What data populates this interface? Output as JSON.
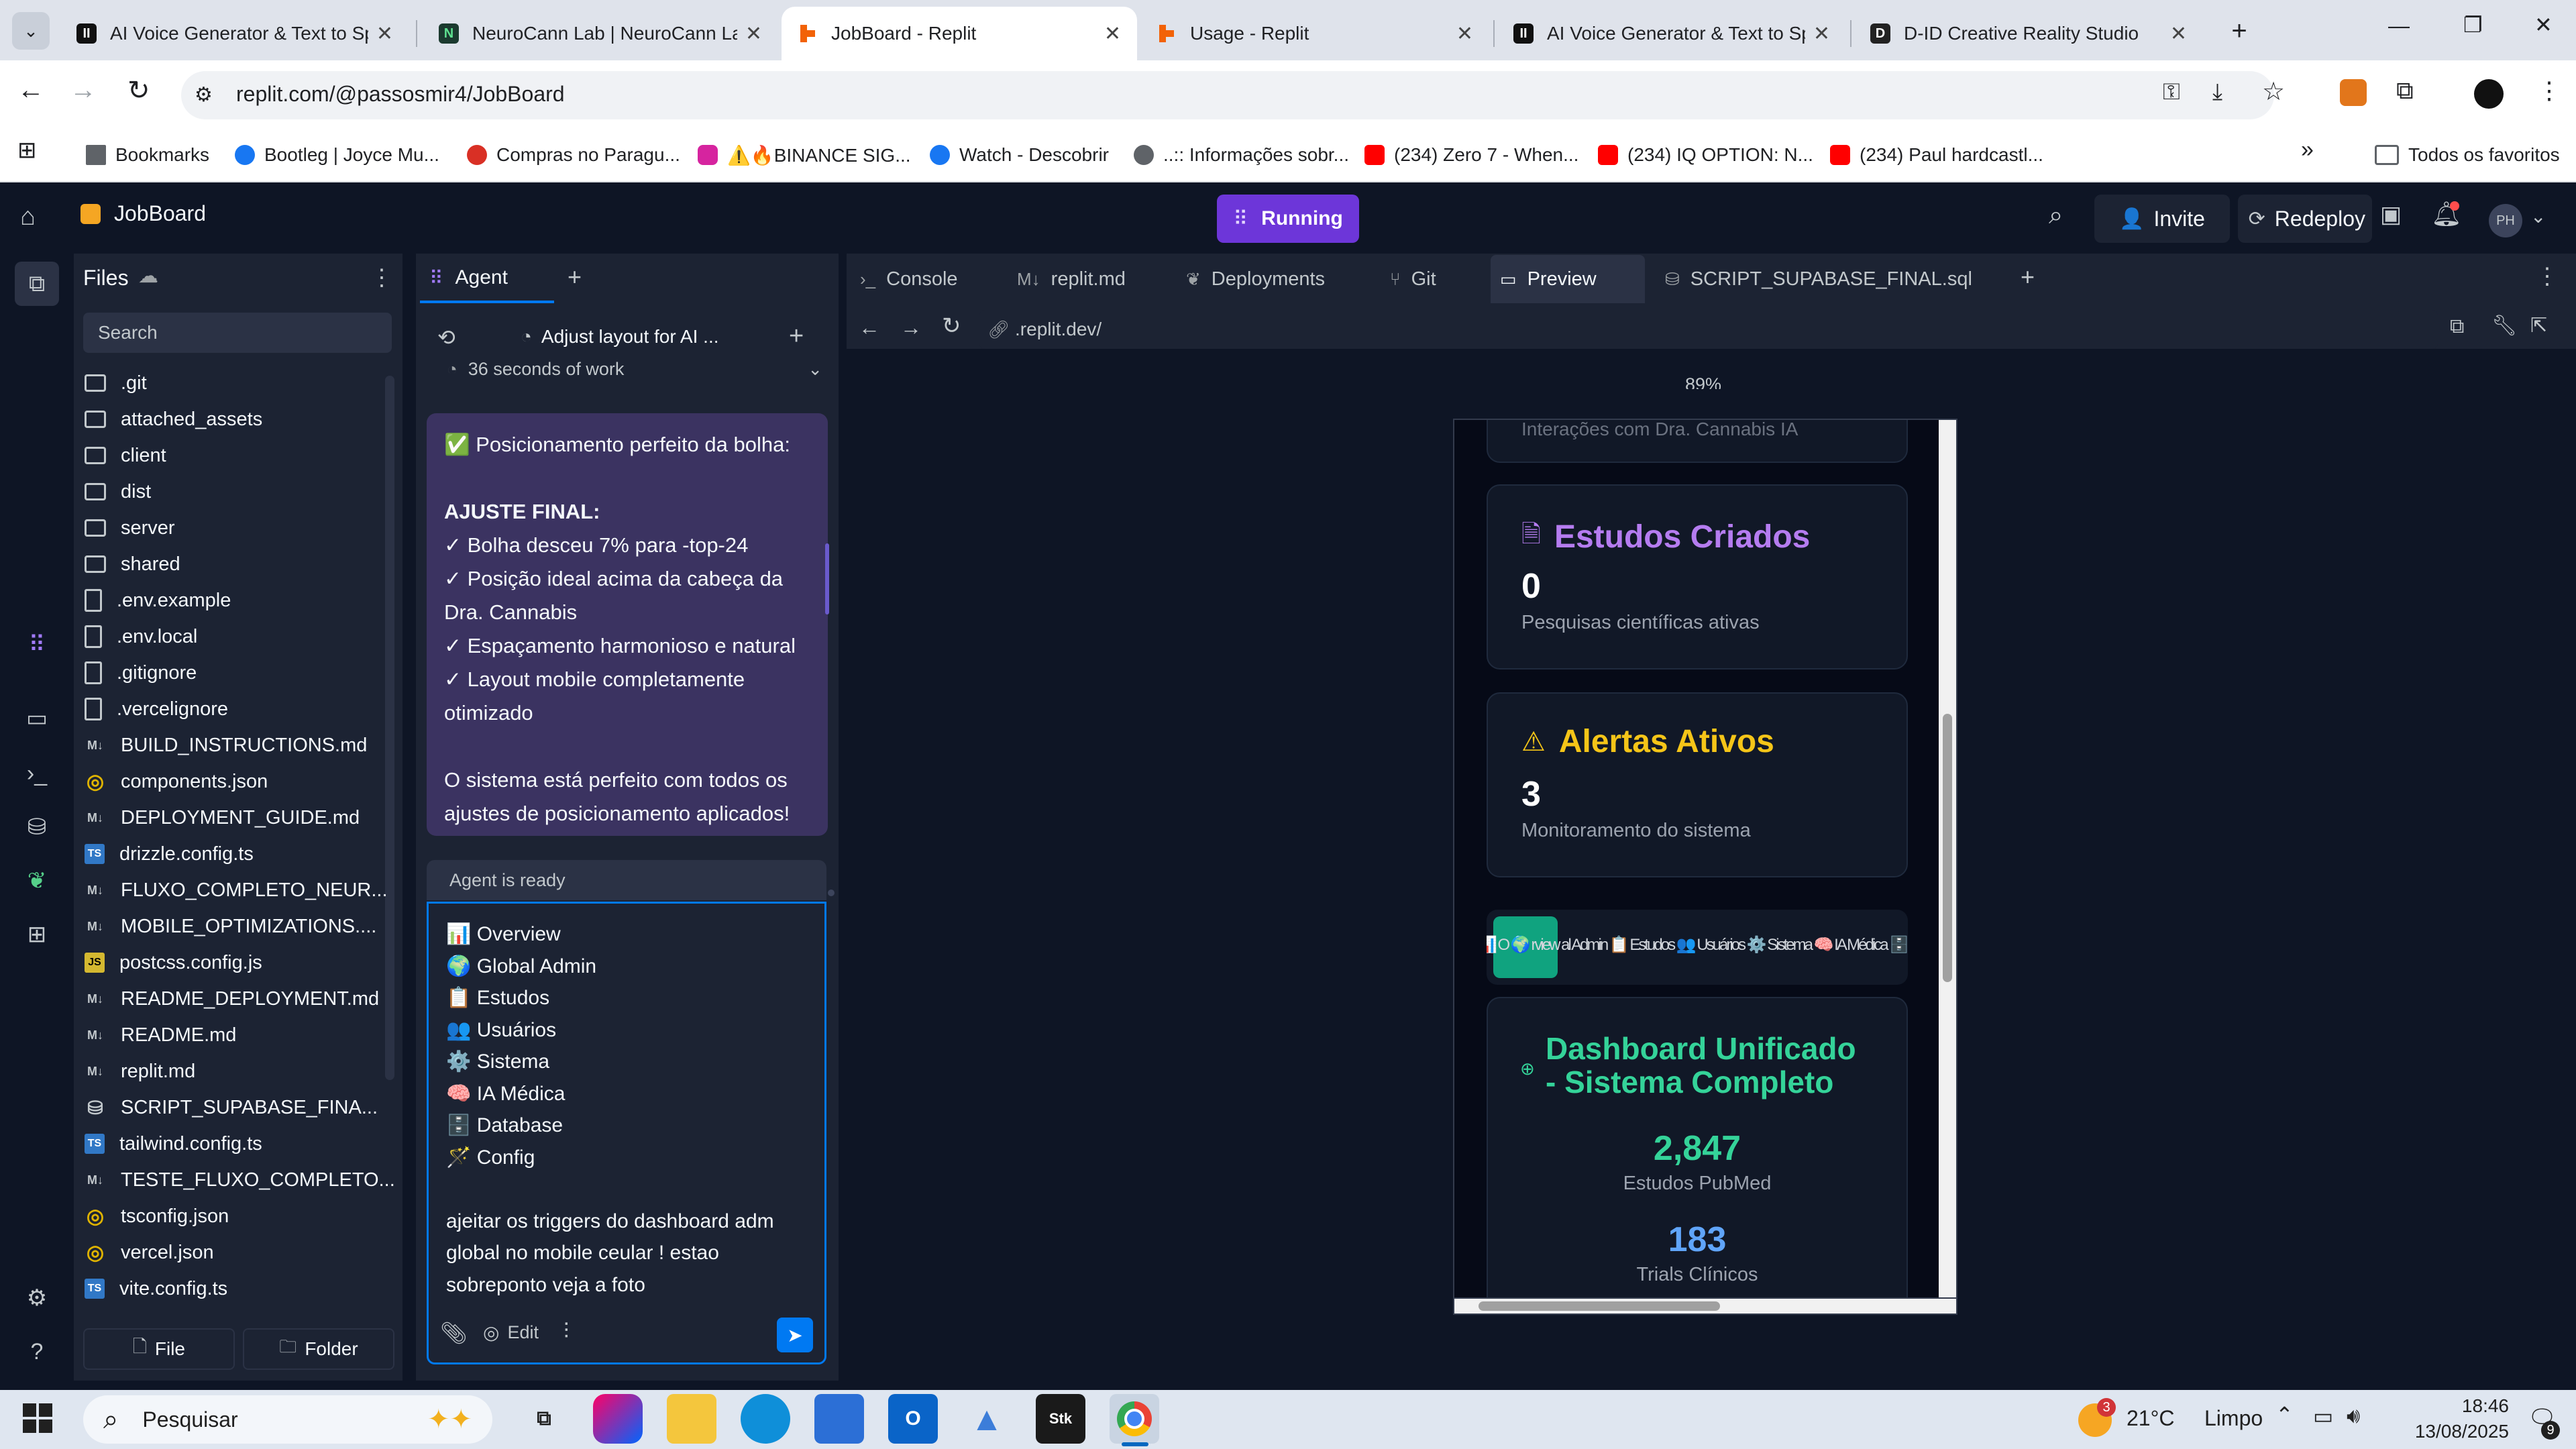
{
  "browser": {
    "tabs": [
      {
        "title": "AI Voice Generator & Text to Sp",
        "fav_color": "#111111",
        "fav_glyph": "II",
        "active": false
      },
      {
        "title": "NeuroCann Lab | NeuroCann La",
        "fav_color": "#1b3a2f",
        "fav_glyph": "N",
        "active": false
      },
      {
        "title": "JobBoard - Replit",
        "fav_color": "#f26207",
        "fav_glyph": "R",
        "active": true
      },
      {
        "title": "Usage - Replit",
        "fav_color": "#f26207",
        "fav_glyph": "R",
        "active": false
      },
      {
        "title": "AI Voice Generator & Text to Sp",
        "fav_color": "#111111",
        "fav_glyph": "II",
        "active": false
      },
      {
        "title": "D-ID Creative Reality Studio",
        "fav_color": "#222222",
        "fav_glyph": "D",
        "active": false
      }
    ],
    "new_tab": "+",
    "url": "replit.com/@passosmir4/JobBoard",
    "bookmarks": [
      {
        "label": "Bookmarks",
        "icon": "star-icon",
        "color": "#5f6368"
      },
      {
        "label": "Bootleg | Joyce Mu...",
        "icon": "facebook-icon",
        "color": "#1877f2"
      },
      {
        "label": "Compras no Paragu...",
        "icon": "pin-icon",
        "color": "#d93025"
      },
      {
        "label": "⚠️🔥BINANCE SIG...",
        "icon": "instagram-icon",
        "color": "#d6249f"
      },
      {
        "label": "Watch - Descobrir",
        "icon": "facebook-icon",
        "color": "#1877f2"
      },
      {
        "label": "..:: Informações sobr...",
        "icon": "globe-icon",
        "color": "#5f6368"
      },
      {
        "label": "(234) Zero 7 - When...",
        "icon": "youtube-icon",
        "color": "#ff0000"
      },
      {
        "label": "(234) IQ OPTION: N...",
        "icon": "youtube-icon",
        "color": "#ff0000"
      },
      {
        "label": "(234) Paul hardcastl...",
        "icon": "youtube-icon",
        "color": "#ff0000"
      }
    ],
    "all_bookmarks": "Todos os favoritos"
  },
  "replit": {
    "project": "JobBoard",
    "status": "Running",
    "invite": "Invite",
    "redeploy": "Redeploy",
    "avatar": "PH",
    "files_title": "Files",
    "search_placeholder": "Search",
    "files": [
      {
        "name": ".git",
        "type": "folder"
      },
      {
        "name": "attached_assets",
        "type": "folder"
      },
      {
        "name": "client",
        "type": "folder"
      },
      {
        "name": "dist",
        "type": "folder"
      },
      {
        "name": "server",
        "type": "folder"
      },
      {
        "name": "shared",
        "type": "folder"
      },
      {
        "name": ".env.example",
        "type": "doc"
      },
      {
        "name": ".env.local",
        "type": "doc"
      },
      {
        "name": ".gitignore",
        "type": "doc"
      },
      {
        "name": ".vercelignore",
        "type": "doc"
      },
      {
        "name": "BUILD_INSTRUCTIONS.md",
        "type": "md"
      },
      {
        "name": "components.json",
        "type": "json"
      },
      {
        "name": "DEPLOYMENT_GUIDE.md",
        "type": "md"
      },
      {
        "name": "drizzle.config.ts",
        "type": "ts"
      },
      {
        "name": "FLUXO_COMPLETO_NEUR...",
        "type": "md"
      },
      {
        "name": "MOBILE_OPTIMIZATIONS....",
        "type": "md"
      },
      {
        "name": "postcss.config.js",
        "type": "js"
      },
      {
        "name": "README_DEPLOYMENT.md",
        "type": "md"
      },
      {
        "name": "README.md",
        "type": "md"
      },
      {
        "name": "replit.md",
        "type": "md"
      },
      {
        "name": "SCRIPT_SUPABASE_FINA...",
        "type": "db"
      },
      {
        "name": "tailwind.config.ts",
        "type": "ts"
      },
      {
        "name": "TESTE_FLUXO_COMPLETO...",
        "type": "md"
      },
      {
        "name": "tsconfig.json",
        "type": "json"
      },
      {
        "name": "vercel.json",
        "type": "json"
      },
      {
        "name": "vite.config.ts",
        "type": "ts"
      }
    ],
    "file_button": "File",
    "folder_button": "Folder",
    "agent": {
      "tab": "Agent",
      "task_title": "Adjust layout for AI ...",
      "work_time": "36 seconds of work",
      "message_lines": [
        "✅ Posicionamento perfeito da bolha:",
        "",
        "AJUSTE FINAL:",
        "✓ Bolha desceu 7% para -top-24",
        "✓ Posição ideal acima da cabeça da",
        "Dra. Cannabis",
        "✓ Espaçamento harmonioso e natural",
        "✓ Layout mobile completamente",
        "otimizado",
        "",
        "O sistema está perfeito com todos os",
        "ajustes de posicionamento aplicados!"
      ],
      "ready": "Agent is ready",
      "input_lines": [
        "📊 Overview",
        "🌍 Global Admin",
        "📋 Estudos",
        "👥 Usuários",
        "⚙️ Sistema",
        "🧠 IA Médica",
        "🗄️ Database",
        "🪄 Config",
        "",
        "ajeitar os triggers do dashboard adm",
        "global no mobile ceular ! estao",
        "sobreponto veja a foto"
      ],
      "edit": "Edit"
    },
    "workspace_tabs": [
      "Console",
      "replit.md",
      "Deployments",
      "Git",
      "Preview",
      "SCRIPT_SUPABASE_FINAL.sql"
    ],
    "preview_url": ".replit.dev/",
    "zoom": "89%",
    "mobile": {
      "cut_text": "Interações com Dra. Cannabis IA",
      "card1_title": "Estudos Criados",
      "card1_value": "0",
      "card1_sub": "Pesquisas científicas ativas",
      "card2_title": "Alertas Ativos",
      "card2_value": "3",
      "card2_sub": "Monitoramento do sistema",
      "nav_text": "📊 O 🌍 rview  al Admin 📋 Estudos 👥 Usuários ⚙️ Sistema 🧠 IA Médica 🗄️ Database 🪄 Config",
      "card3_title_1": "Dashboard Unificado",
      "card3_title_2": "- Sistema Completo",
      "stat1_value": "2,847",
      "stat1_label": "Estudos PubMed",
      "stat2_value": "183",
      "stat2_label": "Trials Clínicos"
    }
  },
  "taskbar": {
    "search": "Pesquisar",
    "weather_temp": "21°C",
    "weather_text": "Limpo",
    "weather_badge": "3",
    "time": "18:46",
    "date": "13/08/2025",
    "notif_count": "9"
  }
}
